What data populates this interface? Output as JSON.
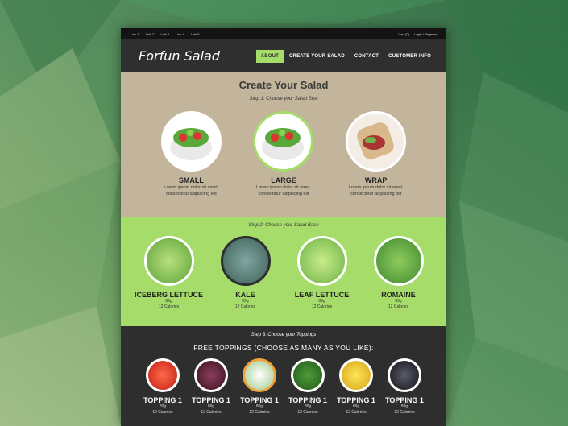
{
  "topbar": {
    "links": [
      "Link 1",
      "Link 2",
      "Link 3",
      "Link 4",
      "Link 5"
    ],
    "cart": "Cart (0)",
    "login": "Login / Register"
  },
  "header": {
    "logo": "Forfun Salad",
    "nav": [
      "ABOUT",
      "CREATE YOUR SALAD",
      "CONTACT",
      "CUSTOMER INFO"
    ]
  },
  "step1": {
    "title": "Create Your Salad",
    "label": "Step 1: Choose your Salad Size",
    "items": [
      {
        "name": "SMALL",
        "line1": "Lorem ipsum dolor sit amet,",
        "line2": "consectetur adipiscing elit"
      },
      {
        "name": "LARGE",
        "line1": "Lorem ipsum dolor sit amet,",
        "line2": "consectetur adipiscing elit"
      },
      {
        "name": "WRAP",
        "line1": "Lorem ipsum dolor sit amet,",
        "line2": "consectetur adipiscing elit"
      }
    ]
  },
  "step2": {
    "label": "Step 2: Choose your Salad Base",
    "items": [
      {
        "name": "ICEBERG LETTUCE",
        "weight": "89g",
        "cal": "12 Calories"
      },
      {
        "name": "KALE",
        "weight": "89g",
        "cal": "12 Calories"
      },
      {
        "name": "LEAF LETTUCE",
        "weight": "89g",
        "cal": "12 Calories"
      },
      {
        "name": "ROMAINE",
        "weight": "89g",
        "cal": "12 Calories"
      }
    ]
  },
  "step3": {
    "label": "Step 3: Choose your Toppings",
    "free": "FREE TOPPINGS (CHOOSE AS MANY AS YOU LIKE):",
    "items": [
      {
        "name": "TOPPING 1",
        "weight": "89g",
        "cal": "12 Calories"
      },
      {
        "name": "TOPPING 1",
        "weight": "89g",
        "cal": "12 Calories"
      },
      {
        "name": "TOPPING 1",
        "weight": "89g",
        "cal": "12 Calories"
      },
      {
        "name": "TOPPING 1",
        "weight": "89g",
        "cal": "12 Calories"
      },
      {
        "name": "TOPPING 1",
        "weight": "89g",
        "cal": "12 Calories"
      },
      {
        "name": "TOPPING 1",
        "weight": "89g",
        "cal": "12 Calories"
      }
    ]
  },
  "colors": {
    "accent": "#a6dd6a",
    "beige": "#c2b59c",
    "dark": "#2e2e2e",
    "topping_selected": "#f0a23a"
  }
}
